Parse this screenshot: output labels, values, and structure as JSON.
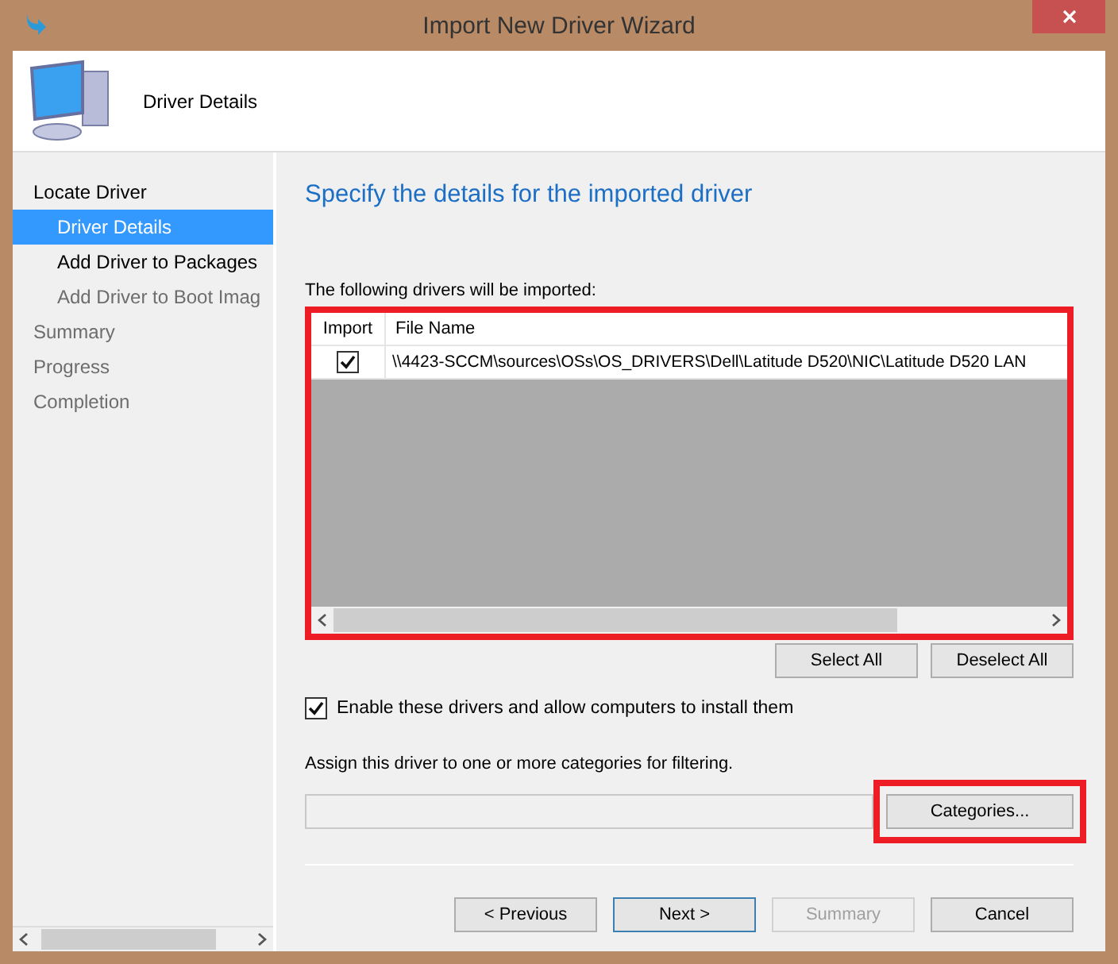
{
  "window": {
    "title": "Import New Driver Wizard"
  },
  "header": {
    "title": "Driver Details"
  },
  "steps": [
    {
      "label": "Locate Driver",
      "selected": false,
      "disabled": false,
      "children": [
        {
          "label": "Driver Details",
          "selected": true,
          "disabled": false
        },
        {
          "label": "Add Driver to Packages",
          "selected": false,
          "disabled": false
        },
        {
          "label": "Add Driver to Boot Imag",
          "selected": false,
          "disabled": true
        }
      ]
    },
    {
      "label": "Summary",
      "selected": false,
      "disabled": true
    },
    {
      "label": "Progress",
      "selected": false,
      "disabled": true
    },
    {
      "label": "Completion",
      "selected": false,
      "disabled": true
    }
  ],
  "page": {
    "heading": "Specify the details for the imported driver",
    "list_label": "The following drivers will be imported:",
    "table": {
      "columns": [
        "Import",
        "File Name"
      ],
      "rows": [
        {
          "checked": true,
          "file_name": "\\\\4423-SCCM\\sources\\OSs\\OS_DRIVERS\\Dell\\Latitude D520\\NIC\\Latitude D520 LAN"
        }
      ]
    },
    "list_buttons": [
      "Select All",
      "Deselect All"
    ],
    "enable": {
      "label": "Enable these drivers and allow computers to install them",
      "checked": true
    },
    "categories_label": "Assign this driver to one or more categories for filtering.",
    "categories_button": "Categories..."
  },
  "buttons": [
    {
      "label": "< Previous",
      "disabled": false,
      "default": false
    },
    {
      "label": "Next >",
      "disabled": false,
      "default": true
    },
    {
      "label": "Summary",
      "disabled": true,
      "default": false
    },
    {
      "label": "Cancel",
      "disabled": false,
      "default": false
    }
  ]
}
